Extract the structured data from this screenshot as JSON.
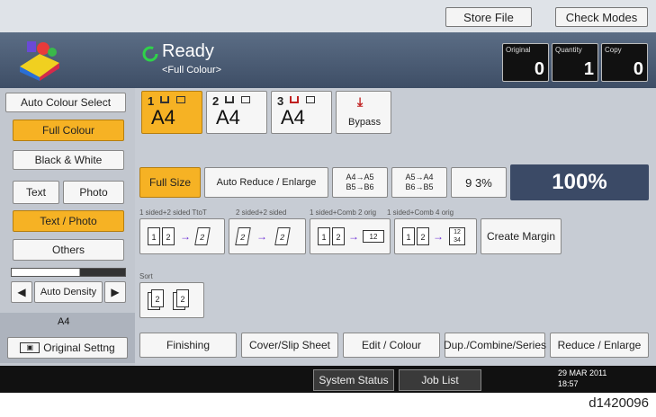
{
  "toolbar": {
    "store_file": "Store File",
    "check_modes": "Check Modes"
  },
  "status": {
    "title": "Ready",
    "subtitle": "<Full Colour>",
    "original_label": "Original",
    "original_value": "0",
    "quantity_label": "Quantity",
    "quantity_value": "1",
    "copy_label": "Copy",
    "copy_value": "0"
  },
  "colour_modes": {
    "auto": "Auto Colour Select",
    "full": "Full Colour",
    "bw": "Black & White"
  },
  "original_type": {
    "text": "Text",
    "photo": "Photo",
    "text_photo": "Text / Photo",
    "others": "Others"
  },
  "density": {
    "label": "Auto Density",
    "left": "◀",
    "right": "▶"
  },
  "original_settings": {
    "size": "A4",
    "label": "Original Settng"
  },
  "trays": [
    {
      "num": "1",
      "size": "A4"
    },
    {
      "num": "2",
      "size": "A4"
    },
    {
      "num": "3",
      "size": "A4"
    }
  ],
  "bypass": "Bypass",
  "reduce": {
    "full_size": "Full Size",
    "auto": "Auto Reduce / Enlarge",
    "r1_a": "A4→A5",
    "r1_b": "B5→B6",
    "r2_a": "A5→A4",
    "r2_b": "B6→B5",
    "pct93": "9 3%",
    "pct100": "100%"
  },
  "duplex": {
    "l1": "1 sided+2 sided TtoT",
    "l2": "2 sided+2 sided",
    "l3": "1 sided+Comb 2 orig",
    "l4": "1 sided+Comb 4 orig",
    "create_margin": "Create Margin"
  },
  "sort_label": "Sort",
  "tabs": {
    "finishing": "Finishing",
    "cover": "Cover/Slip Sheet",
    "edit": "Edit / Colour",
    "dup": "Dup./Combine/Series",
    "reduce": "Reduce / Enlarge"
  },
  "footer": {
    "system_status": "System Status",
    "job_list": "Job List",
    "date": "29 MAR  2011",
    "time": "18:57"
  },
  "caption": "d1420096",
  "colors": {
    "accent": "#f6b224",
    "status_bg": "#4a5a73",
    "zoom_bg": "#3b4a66"
  }
}
